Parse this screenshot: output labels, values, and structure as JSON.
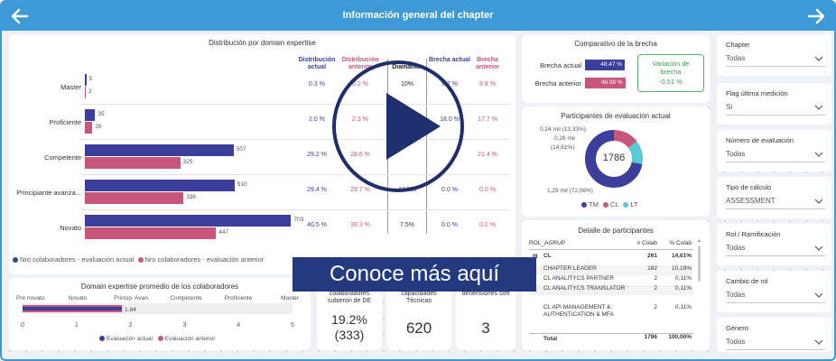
{
  "header": {
    "title": "Información general del chapter"
  },
  "dist": {
    "title": "Distribución por domain expertise",
    "col_actual": "Distribución actual",
    "col_anterior": "Distribución anterior",
    "col_diamante": "Diamante",
    "col_brecha_actual": "Brecha actual",
    "col_brecha_anterior": "Brecha anterior",
    "rows": [
      {
        "label": "Master",
        "actual": 5,
        "anterior": 2,
        "dist_actual": "0.3 %",
        "dist_anterior": "0.2 %",
        "diamante": "10%",
        "brecha_actual": "9.7 %",
        "brecha_anterior": "9.8 %"
      },
      {
        "label": "Proficiente",
        "actual": 35,
        "anterior": 26,
        "dist_actual": "2.0 %",
        "dist_anterior": "2.3 %",
        "diamante": "",
        "brecha_actual": "18.0 %",
        "brecha_anterior": "17.7 %"
      },
      {
        "label": "Competente",
        "actual": 507,
        "anterior": 325,
        "dist_actual": "29.2 %",
        "dist_anterior": "28.6 %",
        "diamante": "",
        "brecha_actual": "",
        "brecha_anterior": "21.4 %"
      },
      {
        "label": "Principiante avanza...",
        "actual": 510,
        "anterior": 336,
        "dist_actual": "29.4 %",
        "dist_anterior": "29.7 %",
        "diamante": "12.5%",
        "brecha_actual": "0.0 %",
        "brecha_anterior": "0.0 %"
      },
      {
        "label": "Novato",
        "actual": 703,
        "anterior": 447,
        "dist_actual": "40.5 %",
        "dist_anterior": "39.3 %",
        "diamante": "7.5%",
        "brecha_actual": "0.0 %",
        "brecha_anterior": "0.0 %"
      }
    ],
    "legend_actual": "Nro colaboradores - evaluación actual",
    "legend_anterior": "Nro colaboradores - evaluación anterior"
  },
  "brecha": {
    "title": "Comparativo de la brecha",
    "label_actual": "Brecha actual",
    "label_anterior": "Brecha anterior",
    "value_actual": "48.47 %",
    "value_anterior": "48.98 %",
    "fill_actual": 0.4847,
    "fill_anterior": 0.4898,
    "var_title": "Variación de brecha",
    "var_value": "-0.51 %"
  },
  "participantes": {
    "title": "Participantes de evaluación actual",
    "center": "1786",
    "lbl_lt": "0,24 mil (13,33%)",
    "lbl_cl1": "0,26 mil",
    "lbl_cl2": "(14,61%)",
    "lbl_tm": "1,29 mil (72,06%)",
    "legend": [
      "TM",
      "CL",
      "LT"
    ]
  },
  "detalle": {
    "title": "Detalle de participantes",
    "col_rol": "ROL_AGRUP",
    "col_colab": "# Colab",
    "col_pct": "% Colab",
    "group": {
      "name": "CL",
      "colab": "261",
      "pct": "14,61%"
    },
    "rows": [
      {
        "name": "CHAPTER LEADER",
        "colab": "182",
        "pct": "10,19%"
      },
      {
        "name": "CL ANALITYCS PARTNER",
        "colab": "2",
        "pct": "0,11%"
      },
      {
        "name": "CL ANALITYCS TRANSLATOR",
        "colab": "2",
        "pct": "0,11%"
      },
      {
        "name": "CL API MANAGEMENT & AUTHENTICATION & MFA",
        "colab": "2",
        "pct": "0,11%"
      }
    ],
    "total_label": "Total",
    "total_colab": "1786",
    "total_pct": "100,00%"
  },
  "promedio": {
    "title": "Domain expertise promedio de los colaboradores",
    "levels": [
      "Pre novato",
      "Novato",
      "Princip. Avan.",
      "Competente",
      "Proficiente",
      "Master"
    ],
    "ticks": [
      "0",
      "1",
      "2",
      "3",
      "4",
      "5"
    ],
    "value_label": "1.84",
    "value_actual": 1.84,
    "value_anterior": 1.84,
    "legend_actual": "Evaluación actual",
    "legend_anterior": "Evaluación anterior"
  },
  "kpis": [
    {
      "label": "colaboradores subieron de DE",
      "value": "19.2%",
      "value2": "(333)"
    },
    {
      "label": "capacidades Técnicas",
      "value": "620",
      "value2": ""
    },
    {
      "label": "dimensiones soft",
      "value": "3",
      "value2": ""
    }
  ],
  "slicers": [
    {
      "label": "Chapter",
      "value": "Todas"
    },
    {
      "label": "Flag última medición",
      "value": "Si"
    },
    {
      "label": "Número de evaluación",
      "value": "Todas"
    },
    {
      "label": "Tipo de cálculo",
      "value": "ASSESSMENT"
    },
    {
      "label": "Rol / Ramificación",
      "value": "Todas"
    },
    {
      "label": "Cambio de rol",
      "value": "Todas"
    },
    {
      "label": "Género",
      "value": "Todas"
    }
  ],
  "banner": {
    "text": "Conoce más aquí"
  },
  "colors": {
    "accent": "#3d9ad6",
    "actual": "#3b3e9b",
    "anterior": "#c8557a",
    "teal": "#5bc8d6",
    "banner": "#233a80"
  }
}
